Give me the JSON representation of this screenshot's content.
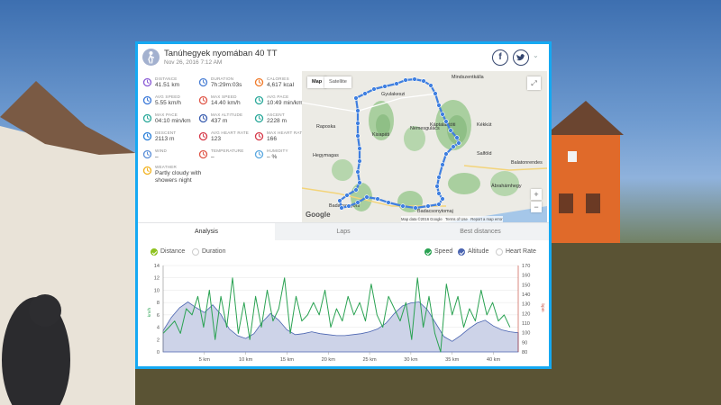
{
  "header": {
    "title": "Tanúhegyek nyomában 40 TT",
    "date": "Nov 26, 2016 7:12 AM",
    "facebook_glyph": "f",
    "chevron_glyph": "⌄",
    "avatar_icon": "hiker-icon"
  },
  "stats": [
    {
      "label": "DISTANCE",
      "value": "41.51 km",
      "icon": "route-icon",
      "color": "#8a5bd6"
    },
    {
      "label": "DURATION",
      "value": "7h:29m:03s",
      "icon": "stopwatch-icon",
      "color": "#4a7fd4"
    },
    {
      "label": "CALORIES",
      "value": "4,617 kcal",
      "icon": "flame-icon",
      "color": "#f07a2a"
    },
    {
      "label": "AVG SPEED",
      "value": "5.55 km/h",
      "icon": "speedometer-icon",
      "color": "#3a78d8"
    },
    {
      "label": "MAX SPEED",
      "value": "14.40 km/h",
      "icon": "speedometer-icon",
      "color": "#e0584a"
    },
    {
      "label": "AVG PACE",
      "value": "10:49 min/km",
      "icon": "speedometer-icon",
      "color": "#2aa89a"
    },
    {
      "label": "MAX PACE",
      "value": "04:10 min/km",
      "icon": "speedometer-icon",
      "color": "#2aa89a"
    },
    {
      "label": "MAX ALTITUDE",
      "value": "437 m",
      "icon": "mountain-icon",
      "color": "#3c5fb0"
    },
    {
      "label": "ASCENT",
      "value": "2228 m",
      "icon": "ascent-icon",
      "color": "#2aa89a"
    },
    {
      "label": "DESCENT",
      "value": "2113 m",
      "icon": "descent-icon",
      "color": "#2a7fd8"
    },
    {
      "label": "AVG HEART RATE",
      "value": "123",
      "icon": "heart-icon",
      "color": "#d63a4a"
    },
    {
      "label": "MAX HEART RATE",
      "value": "166",
      "icon": "heart-icon",
      "color": "#d63a4a"
    },
    {
      "label": "WIND",
      "value": "–",
      "icon": "wind-icon",
      "color": "#5b8fd8"
    },
    {
      "label": "TEMPERATURE",
      "value": "–",
      "icon": "thermometer-icon",
      "color": "#e0584a"
    },
    {
      "label": "HUMIDITY",
      "value": "– %",
      "icon": "droplet-icon",
      "color": "#5ba8e0"
    }
  ],
  "weather": {
    "label": "WEATHER",
    "value": "Partly cloudy with showers night",
    "icon": "weather-icon",
    "color": "#f2b21e"
  },
  "map": {
    "map_label": "Map",
    "satellite_label": "Satellite",
    "zoom_in": "+",
    "zoom_out": "−",
    "fullscreen_glyph": "⤢",
    "google": "Google",
    "map_data": "Map data ©2016 Google",
    "terms": "Terms of Use",
    "report": "Report a map error",
    "places": [
      "Mindszentkálla",
      "Gyulakeszi",
      "Raposka",
      "Kisapáti",
      "Káptalantóti",
      "Kékkút",
      "Nemesgulács",
      "Hegymagas",
      "Salföld",
      "Badacsonytomaj",
      "Ábrahámhegy",
      "Badacsonyörs",
      "Balatonrendes"
    ],
    "route_color": "#3f7fe0"
  },
  "tabs": [
    {
      "label": "Analysis",
      "active": true
    },
    {
      "label": "Laps",
      "active": false
    },
    {
      "label": "Best distances",
      "active": false
    }
  ],
  "toggles": {
    "distance": "Distance",
    "duration": "Duration",
    "speed": "Speed",
    "altitude": "Altitude",
    "heart_rate": "Heart Rate"
  },
  "colors": {
    "accent": "#15a9f2",
    "speed": "#2aa252",
    "altitude": "#4963b0",
    "altitude_fill": "#cdd3e8",
    "distance": "#8ec21f"
  },
  "chart_data": {
    "type": "line",
    "xlabel": "",
    "ylabel": "km/h",
    "y2label": "bpm",
    "xlim": [
      0,
      43
    ],
    "ylim": [
      0,
      14
    ],
    "y2lim": [
      80,
      170
    ],
    "x_ticks": [
      5,
      10,
      15,
      20,
      25,
      30,
      35,
      40
    ],
    "x_tick_labels": [
      "5 km",
      "10 km",
      "15 km",
      "20 km",
      "25 km",
      "30 km",
      "35 km",
      "40 km"
    ],
    "y_ticks": [
      0,
      2,
      4,
      6,
      8,
      10,
      12,
      14
    ],
    "y2_ticks": [
      80,
      90,
      100,
      110,
      120,
      130,
      140,
      150,
      160,
      170
    ],
    "grid": true,
    "series": [
      {
        "name": "Speed",
        "axis": "left",
        "color": "#2aa252",
        "x": [
          0,
          0.7,
          1.4,
          2.1,
          2.8,
          3.5,
          4.2,
          4.9,
          5.6,
          6.3,
          7,
          7.7,
          8.4,
          9.1,
          9.8,
          10.5,
          11.2,
          11.9,
          12.6,
          13.3,
          14,
          14.7,
          15.4,
          16.1,
          16.8,
          17.5,
          18.2,
          18.9,
          19.6,
          20.3,
          21,
          21.7,
          22.4,
          23.1,
          23.8,
          24.5,
          25.2,
          25.9,
          26.6,
          27.3,
          28,
          28.7,
          29.4,
          30.1,
          30.8,
          31.5,
          32.2,
          32.9,
          33.6,
          34.3,
          35,
          35.7,
          36.4,
          37.1,
          37.8,
          38.5,
          39.2,
          39.9,
          40.6,
          41.3,
          42
        ],
        "y": [
          3,
          4,
          5,
          3,
          7,
          6,
          9,
          4,
          10,
          2,
          9,
          4,
          12,
          3,
          8,
          2,
          9,
          4,
          10,
          5,
          7,
          12,
          3,
          9,
          5,
          6,
          8,
          6,
          10,
          4,
          7,
          5,
          9,
          6,
          8,
          5,
          11,
          6,
          4,
          9,
          7,
          5,
          8,
          2,
          12,
          4,
          9,
          3,
          0,
          11,
          6,
          9,
          4,
          7,
          5,
          10,
          6,
          8,
          5,
          6,
          4
        ]
      },
      {
        "name": "Altitude",
        "axis": "right",
        "color": "#4963b0",
        "x": [
          0,
          1,
          2,
          3,
          4,
          5,
          6,
          7,
          8,
          9,
          10,
          11,
          12,
          13,
          14,
          15,
          16,
          17,
          18,
          19,
          20,
          21,
          22,
          23,
          24,
          25,
          26,
          27,
          28,
          29,
          30,
          31,
          32,
          33,
          34,
          35,
          36,
          37,
          38,
          39,
          40,
          41,
          42,
          43
        ],
        "y": [
          102,
          116,
          126,
          132,
          126,
          121,
          129,
          119,
          104,
          97,
          94,
          99,
          111,
          120,
          113,
          103,
          98,
          99,
          101,
          99,
          98,
          97,
          97,
          98,
          99,
          101,
          104,
          110,
          120,
          128,
          131,
          132,
          124,
          110,
          96,
          91,
          97,
          104,
          110,
          113,
          107,
          103,
          101,
          100
        ]
      }
    ]
  }
}
